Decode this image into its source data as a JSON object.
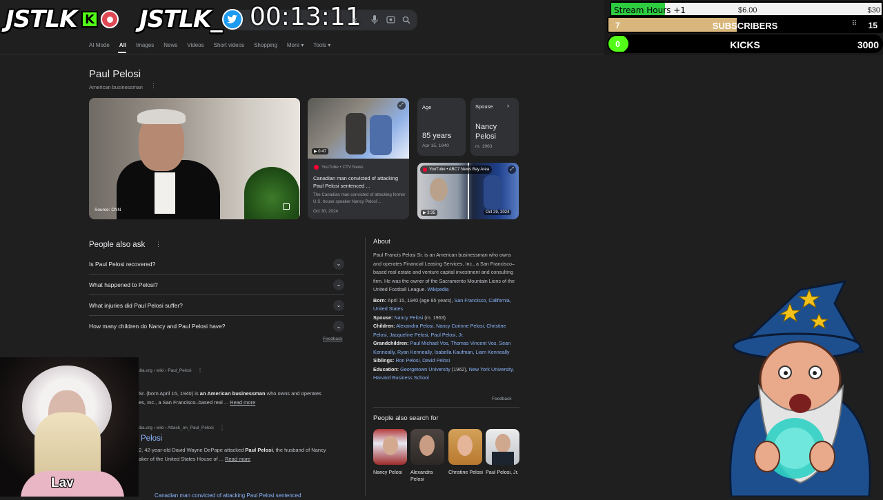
{
  "overlay": {
    "logo1": "JSTLK",
    "logo1_badge": "K",
    "logo2": "JSTLK_",
    "timer": "00:13:11",
    "searchbar_close": "×"
  },
  "stream_bars": {
    "hours_label": "Stream Hours",
    "hours_add": "+1",
    "hours_money": "$6.00",
    "hours_goal": "$30",
    "hours_progress": 0.2,
    "subs_count": "7",
    "subs_label": "SUBSCRIBERS",
    "subs_goal": "15",
    "subs_progress": 0.47,
    "kicks_count": "0",
    "kicks_label": "KICKS",
    "kicks_goal": "3000",
    "kicks_progress": 0
  },
  "tabs": [
    "AI Mode",
    "All",
    "Images",
    "News",
    "Videos",
    "Short videos",
    "Shopping",
    "More ▾",
    "Tools ▾"
  ],
  "kp": {
    "title": "Paul Pelosi",
    "subtitle": "American businessman",
    "main_image_source": "Source: CNN",
    "video1": {
      "duration": "▶ 0:47",
      "source": "YouTube • CTV News",
      "title": "Canadian man convicted of attacking Paul Pelosi sentenced ...",
      "snippet": "The Canadian man convicted of attacking former U.S. house speaker Nancy Pelosi'...",
      "date": "Oct 30, 2024"
    },
    "age_card": {
      "label": "Age",
      "value": "85 years",
      "detail": "Apr 15, 1940"
    },
    "spouse_card": {
      "label": "Spouse",
      "value": "Nancy Pelosi",
      "detail": "m. 1963"
    },
    "video2": {
      "source": "YouTube • ABC7 News Bay Area",
      "duration": "▶ 3:35",
      "date": "Oct 29, 2024"
    }
  },
  "paa": {
    "heading": "People also ask",
    "questions": [
      "Is Paul Pelosi recovered?",
      "What happened to Pelosi?",
      "What injuries did Paul Pelosi suffer?",
      "How many children do Nancy and Paul Pelosi have?"
    ],
    "feedback": "Feedback"
  },
  "results": {
    "r1_url": "dia.org › wiki › Paul_Pelosi",
    "r1_snippet_a": "Sr. (born April 15, 1940) is ",
    "r1_snippet_bold": "an American businessman",
    "r1_snippet_b": " who owns and operates",
    "r1_snippet_line2": "es, Inc., a San Francisco–based real ...",
    "r1_read_more": "Read more",
    "r2_url": "dia.org › wiki › Attack_on_Paul_Pelosi",
    "r2_title": "Pelosi",
    "r2_snippet_a": "2, 42-year-old David Wayne DePape attacked ",
    "r2_snippet_bold": "Paul Pelosi",
    "r2_snippet_b": ", the husband of Nancy",
    "r2_snippet_line2": "aker of the United States House of ...",
    "r2_read_more": "Read more",
    "r3_title": "Canadian man convicted of attacking Paul Pelosi sentenced"
  },
  "about": {
    "heading": "About",
    "text": "Paul Francis Pelosi Sr. is an American businessman who owns and operates Financial Leasing Services, Inc., a San Francisco–based real estate and venture capital investment and consulting firm. He was the owner of the Sacramento Mountain Lions of the United Football League.",
    "wiki": "Wikipedia",
    "born_label": "Born:",
    "born_text": " April 15, 1940 (age 85 years), ",
    "born_link": "San Francisco, California, United States",
    "spouse_label": "Spouse:",
    "spouse_link": "Nancy Pelosi",
    "spouse_text": " (m. 1963)",
    "children_label": "Children:",
    "children_links": "Alexandra Pelosi, Nancy Corinne Pelosi, Christine Pelosi, Jacqueline Pelosi, Paul Pelosi, Jr.",
    "grand_label": "Grandchildren:",
    "grand_links": "Paul Michael Vos, Thomas Vincent Vos, Sean Kenneally, Ryan Kenneally, Isabella Kaufman, Liam Kenneally",
    "siblings_label": "Siblings:",
    "siblings_links": "Ron Pelosi, David Pelosi",
    "edu_label": "Education:",
    "edu_link1": "Georgetown University",
    "edu_text": " (1962), ",
    "edu_link2": "New York University, Harvard Business School",
    "feedback": "Feedback"
  },
  "people_search": {
    "heading": "People also search for",
    "people": [
      "Nancy Pelosi",
      "Alexandra Pelosi",
      "Christine Pelosi",
      "Paul Pelosi, Jr."
    ]
  },
  "webcam": {
    "name": "Lav"
  },
  "colors": {
    "kick_green": "#53fc18",
    "link_blue": "#8ab4f8",
    "page_bg": "#1f1f1f"
  }
}
